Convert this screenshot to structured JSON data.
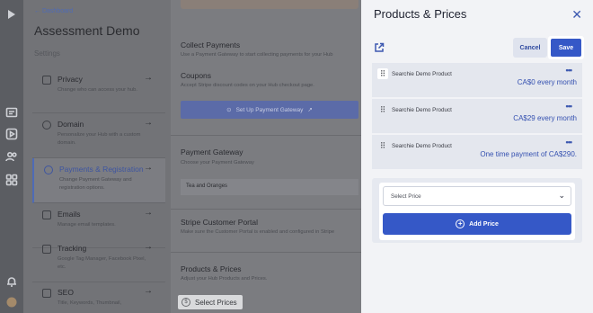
{
  "nav": {
    "back_label": "Dashboard",
    "hub_title": "Assessment Demo",
    "settings_label": "Settings",
    "items": [
      {
        "title": "Privacy",
        "desc": "Change who can access your hub."
      },
      {
        "title": "Domain",
        "desc": "Personalize your Hub with a custom domain."
      },
      {
        "title": "Payments & Registration",
        "desc": "Change Payment Gateway and registration options."
      },
      {
        "title": "Emails",
        "desc": "Manage email templates."
      },
      {
        "title": "Tracking",
        "desc": "Google Tag Manager, Facebook Pixel, etc."
      },
      {
        "title": "SEO",
        "desc": "Title, Keywords, Thumbnail,"
      }
    ]
  },
  "main": {
    "collect_title": "Collect Payments",
    "collect_sub": "Use a Payment Gateway to start collecting payments for your Hub",
    "coupons_title": "Coupons",
    "coupons_sub": "Accept Stripe discount codes on your Hub checkout page.",
    "stripe_button": "Set Up Payment Gateway",
    "gateway_title": "Payment Gateway",
    "gateway_sub": "Choose your Payment Gateway",
    "gateway_value": "Tea and Oranges",
    "portal_title": "Stripe Customer Portal",
    "portal_sub": "Make sure the Customer Portal is enabled and configured in Stripe",
    "products_title": "Products & Prices",
    "products_sub": "Adjust your Hub Products and Prices.",
    "select_prices": "Select Prices"
  },
  "drawer": {
    "title": "Products & Prices",
    "cancel_label": "Cancel",
    "save_label": "Save",
    "products": [
      {
        "name": "Searchie Demo Product",
        "price": "CA$0 every month"
      },
      {
        "name": "Searchie Demo Product",
        "price": "CA$29 every month"
      },
      {
        "name": "Searchie Demo Product",
        "price": "One time payment of CA$290."
      }
    ],
    "select_placeholder": "Select Price",
    "add_price_label": "Add Price"
  },
  "colors": {
    "accent": "#3558c7",
    "drawer_bg": "#f2f3f6"
  }
}
